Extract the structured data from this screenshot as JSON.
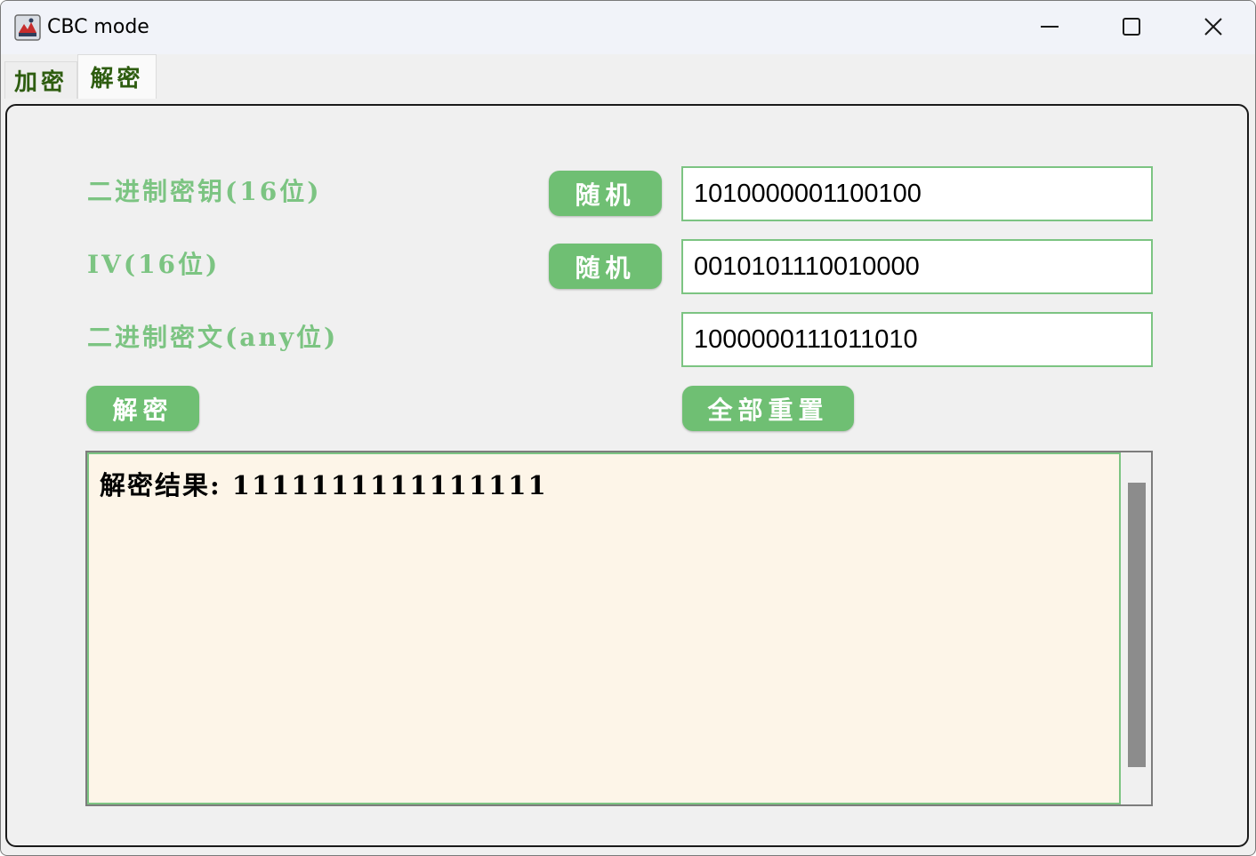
{
  "window": {
    "title": "CBC mode",
    "icon": "java-app-icon"
  },
  "tabs": [
    {
      "label": "加密",
      "selected": false
    },
    {
      "label": "解密",
      "selected": true
    }
  ],
  "form": {
    "key": {
      "label": "二进制密钥(16位)",
      "random_button": "随机",
      "value": "1010000001100100"
    },
    "iv": {
      "label": "IV(16位)",
      "random_button": "随机",
      "value": "0010101110010000"
    },
    "ciphertext": {
      "label": "二进制密文(any位)",
      "value": "1000000111011010"
    },
    "decrypt_button": "解密",
    "reset_button": "全部重置"
  },
  "result": {
    "text": "解密结果: 1111111111111111"
  },
  "colors": {
    "accent_green": "#6fbf73",
    "label_green": "#7cc482",
    "tab_text": "#2e5d10",
    "result_bg": "#fdf5e8"
  }
}
